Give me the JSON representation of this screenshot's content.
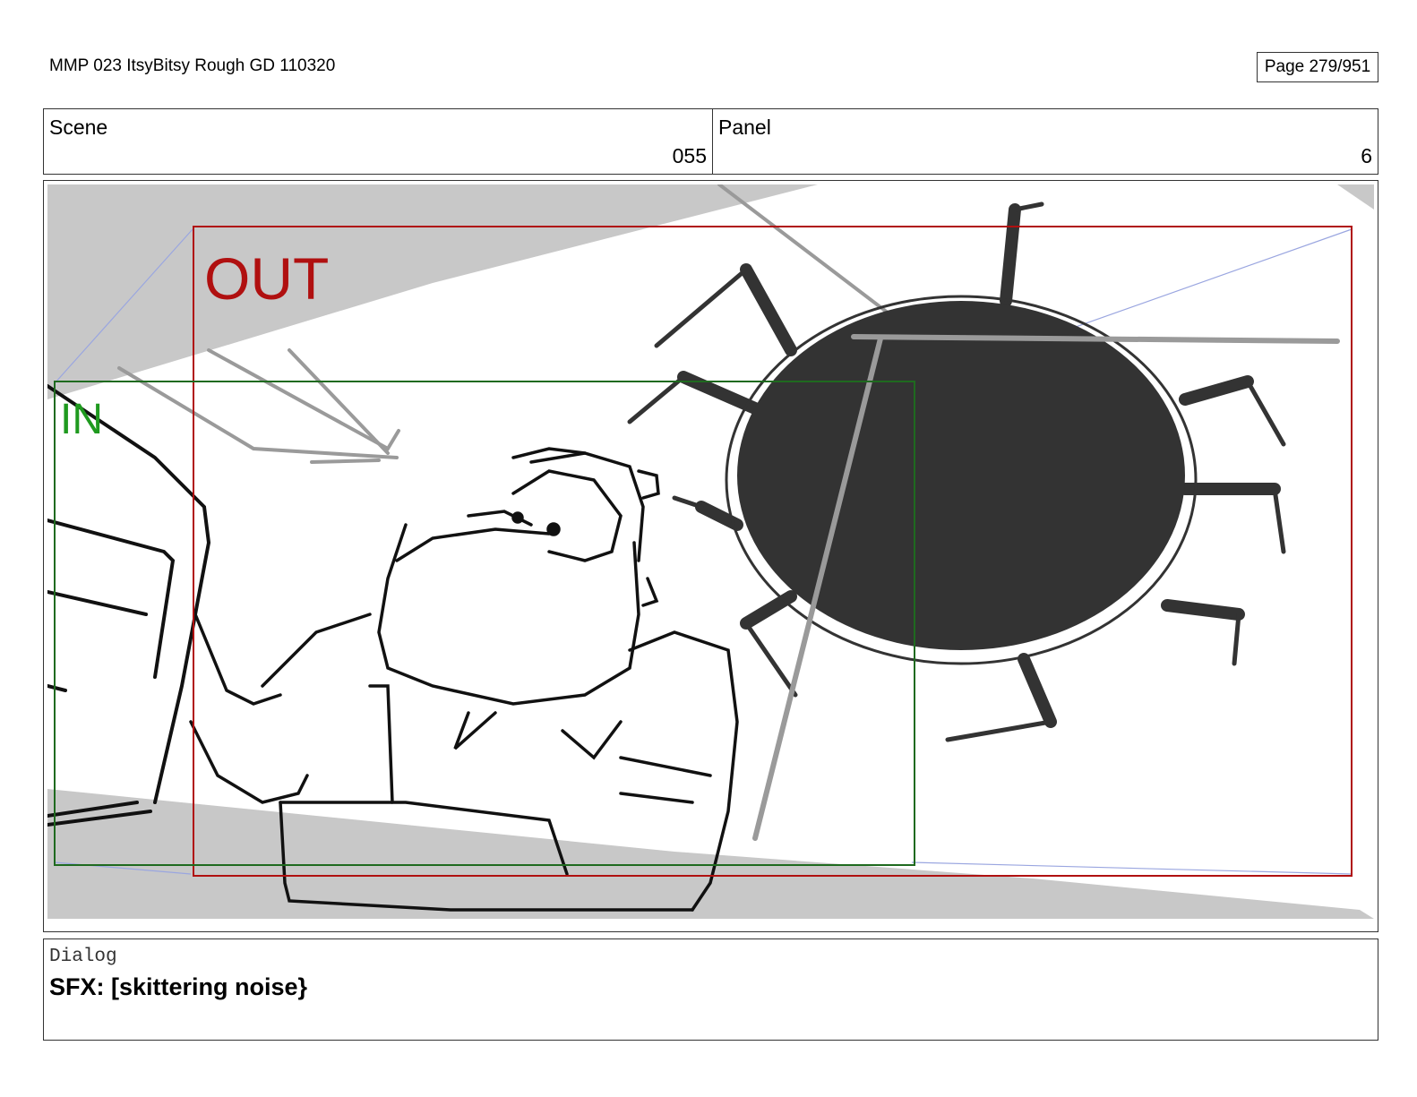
{
  "header": {
    "title": "MMP 023 ItsyBitsy Rough GD 110320",
    "page": "Page 279/951"
  },
  "scene": {
    "label": "Scene",
    "value": "055"
  },
  "panel": {
    "label": "Panel",
    "value": "6"
  },
  "frame": {
    "out_label": "OUT",
    "in_label": "IN",
    "colors": {
      "out": "#b01010",
      "in": "#1f9a1f",
      "spider": "#333333",
      "shadow": "#c8c8c8"
    }
  },
  "dialog": {
    "label": "Dialog",
    "text": "SFX: [skittering noise}"
  }
}
